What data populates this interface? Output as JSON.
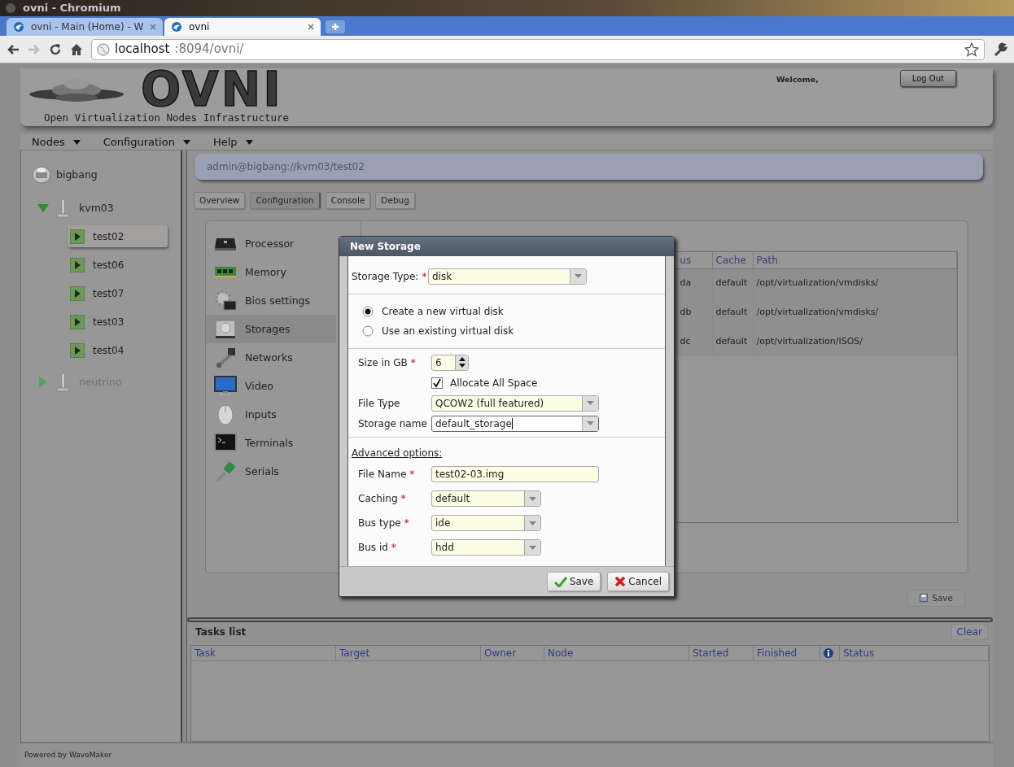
{
  "browser": {
    "window_title": "ovni - Chromium",
    "tabs": [
      {
        "label": "ovni - Main (Home) - W",
        "selected": false
      },
      {
        "label": "ovni",
        "selected": true
      }
    ],
    "url_host": "localhost",
    "url_path": ":8094/ovni/"
  },
  "header": {
    "logo_text": "OVNI",
    "subtitle": "Open Virtualization Nodes Infrastructure",
    "welcome": "Welcome,",
    "logout": "Log Out"
  },
  "menu": [
    "Nodes",
    "Configuration",
    "Help"
  ],
  "tree": {
    "label": "bigbang",
    "kind": "server",
    "selected": false,
    "children": [
      {
        "label": "kvm03",
        "kind": "host",
        "expanded": true,
        "disabled": false,
        "selected": false,
        "children": [
          {
            "label": "test02",
            "kind": "vm",
            "selected": true
          },
          {
            "label": "test06",
            "kind": "vm",
            "selected": false
          },
          {
            "label": "test07",
            "kind": "vm",
            "selected": false
          },
          {
            "label": "test03",
            "kind": "vm",
            "selected": false
          },
          {
            "label": "test04",
            "kind": "vm",
            "selected": false
          }
        ]
      },
      {
        "label": "neutrino",
        "kind": "host",
        "expanded": false,
        "disabled": true,
        "selected": false
      }
    ]
  },
  "breadcrumb": "admin@bigbang://kvm03/test02",
  "tabs": [
    {
      "label": "Overview",
      "selected": false
    },
    {
      "label": "Configuration",
      "selected": true
    },
    {
      "label": "Console",
      "selected": false
    },
    {
      "label": "Debug",
      "selected": false
    }
  ],
  "config_sections": [
    {
      "label": "Processor",
      "selected": false
    },
    {
      "label": "Memory",
      "selected": false
    },
    {
      "label": "Bios settings",
      "selected": false
    },
    {
      "label": "Storages",
      "selected": true
    },
    {
      "label": "Networks",
      "selected": false
    },
    {
      "label": "Video",
      "selected": false
    },
    {
      "label": "Inputs",
      "selected": false
    },
    {
      "label": "Terminals",
      "selected": false
    },
    {
      "label": "Serials",
      "selected": false
    }
  ],
  "storage_table": {
    "columns": [
      "us",
      "Cache",
      "Path"
    ],
    "rows": [
      [
        "da",
        "default",
        "/opt/virtualization/vmdisks/"
      ],
      [
        "db",
        "default",
        "/opt/virtualization/vmdisks/"
      ],
      [
        "dc",
        "default",
        "/opt/virtualization/ISOS/"
      ]
    ]
  },
  "save_button": "Save",
  "dialog": {
    "title": "New Storage",
    "storage_type": {
      "label": "Storage Type:",
      "required_mark": "*",
      "kind": "select",
      "value": "disk",
      "focused": false
    },
    "disk_options": [
      {
        "label": "Create a new virtual disk",
        "selected": true
      },
      {
        "label": "Use an existing virtual disk",
        "selected": false
      }
    ],
    "fields": [
      {
        "kind": "spinner",
        "label": "Size in GB",
        "required_mark": "*",
        "value": "6",
        "focused": false
      },
      {
        "kind": "checkbox",
        "label": "Allocate All Space",
        "checked": true
      },
      {
        "kind": "combo",
        "label": "File Type",
        "value": "QCOW2 (full featured)",
        "focused": false
      },
      {
        "kind": "combo",
        "label": "Storage name",
        "value": "default_storage",
        "focused": true
      }
    ],
    "advanced": {
      "title": "Advanced options:",
      "fields": [
        {
          "kind": "text",
          "label": "File Name",
          "required_mark": "*",
          "value": "test02-03.img",
          "focused": false
        },
        {
          "kind": "select",
          "label": "Caching",
          "required_mark": "*",
          "value": "default",
          "focused": false
        },
        {
          "kind": "select",
          "label": "Bus type",
          "required_mark": "*",
          "value": "ide",
          "focused": false
        },
        {
          "kind": "select",
          "label": "Bus id",
          "required_mark": "*",
          "value": "hdd",
          "focused": false
        }
      ]
    },
    "buttons": [
      {
        "kind": "save",
        "label": "Save"
      },
      {
        "kind": "cancel",
        "label": "Cancel"
      }
    ]
  },
  "tasks": {
    "title": "Tasks list",
    "clear": "Clear",
    "columns": [
      {
        "kind": "text",
        "label": "Task"
      },
      {
        "kind": "text",
        "label": "Target"
      },
      {
        "kind": "text",
        "label": "Owner"
      },
      {
        "kind": "text",
        "label": "Node"
      },
      {
        "kind": "text",
        "label": "Started"
      },
      {
        "kind": "text",
        "label": "Finished"
      },
      {
        "kind": "info"
      },
      {
        "kind": "text",
        "label": "Status"
      }
    ]
  },
  "footer": "Powered by WaveMaker"
}
